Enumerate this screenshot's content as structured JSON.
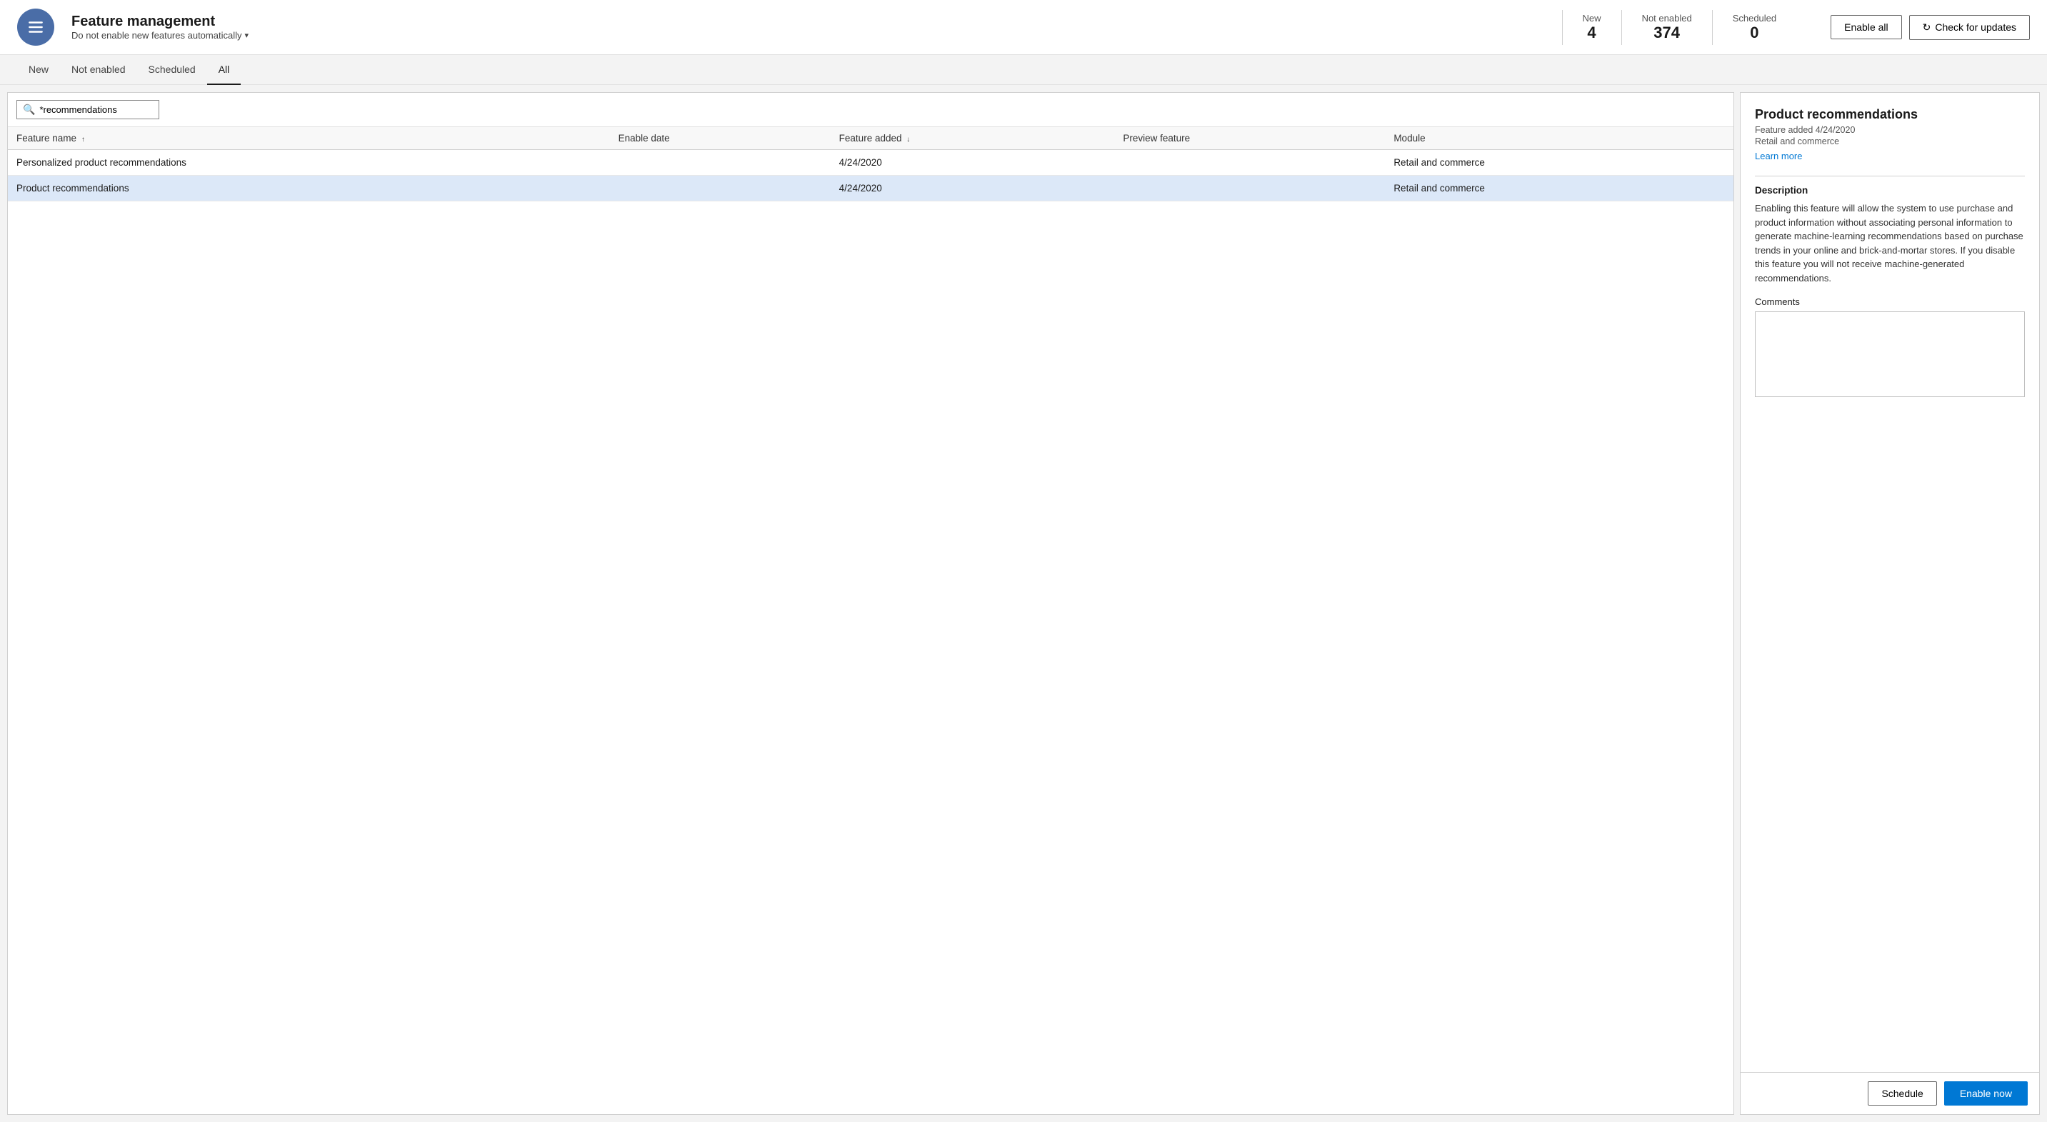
{
  "header": {
    "title": "Feature management",
    "subtitle": "Do not enable new features automatically",
    "icon_label": "menu-icon",
    "stats": {
      "new_label": "New",
      "new_value": "4",
      "not_enabled_label": "Not enabled",
      "not_enabled_value": "374",
      "scheduled_label": "Scheduled",
      "scheduled_value": "0"
    },
    "enable_all_label": "Enable all",
    "check_updates_label": "Check for updates"
  },
  "tabs": [
    {
      "label": "New",
      "active": false
    },
    {
      "label": "Not enabled",
      "active": false
    },
    {
      "label": "Scheduled",
      "active": false
    },
    {
      "label": "All",
      "active": true
    }
  ],
  "search": {
    "placeholder": "*recommendations",
    "value": "*recommendations"
  },
  "table": {
    "columns": [
      {
        "label": "Feature name",
        "sort": "asc"
      },
      {
        "label": "Enable date",
        "sort": null
      },
      {
        "label": "Feature added",
        "sort": "desc"
      },
      {
        "label": "Preview feature",
        "sort": null
      },
      {
        "label": "Module",
        "sort": null
      }
    ],
    "rows": [
      {
        "feature_name": "Personalized product recommendations",
        "enable_date": "",
        "feature_added": "4/24/2020",
        "preview_feature": "",
        "module": "Retail and commerce",
        "selected": false
      },
      {
        "feature_name": "Product recommendations",
        "enable_date": "",
        "feature_added": "4/24/2020",
        "preview_feature": "",
        "module": "Retail and commerce",
        "selected": true
      }
    ]
  },
  "detail": {
    "title": "Product recommendations",
    "feature_added": "Feature added 4/24/2020",
    "module": "Retail and commerce",
    "learn_more_label": "Learn more",
    "description_label": "Description",
    "description": "Enabling this feature will allow the system to use purchase and product information without associating personal information to generate machine-learning recommendations based on purchase trends in your online and brick-and-mortar stores. If you disable this feature you will not receive machine-generated recommendations.",
    "comments_label": "Comments",
    "schedule_label": "Schedule",
    "enable_now_label": "Enable now"
  }
}
